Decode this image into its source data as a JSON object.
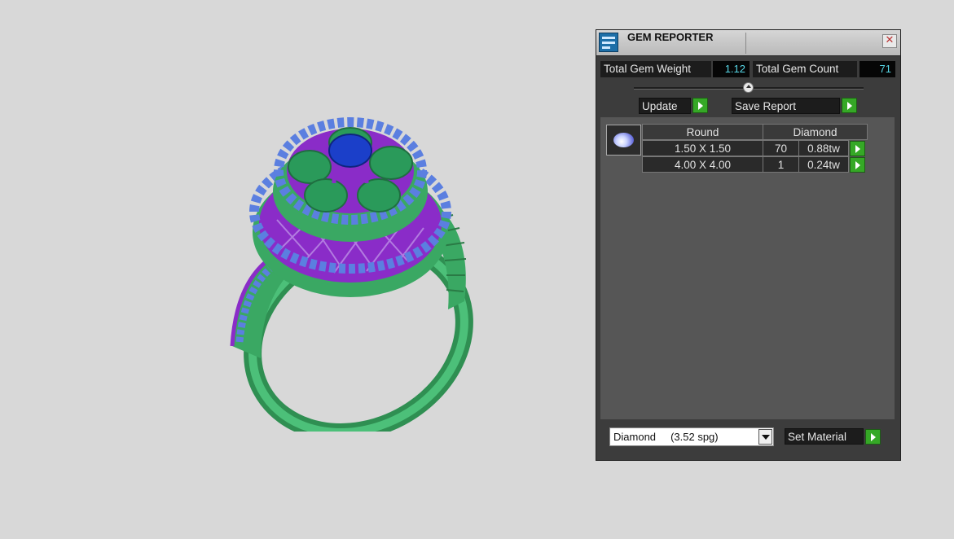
{
  "window": {
    "title": "GEM REPORTER",
    "close_icon": "close-icon",
    "app_icon": "gem-reporter-app-icon"
  },
  "totals": {
    "weight_label": "Total Gem Weight",
    "weight_value": "1.12",
    "count_label": "Total Gem Count",
    "count_value": "71"
  },
  "actions": {
    "update_label": "Update",
    "save_report_label": "Save Report",
    "set_material_label": "Set Material"
  },
  "gem_table": {
    "headers": [
      "Round",
      "Diamond"
    ],
    "rows": [
      {
        "size": "1.50 X 1.50",
        "count": "70",
        "weight": "0.88tw"
      },
      {
        "size": "4.00 X 4.00",
        "count": "1",
        "weight": "0.24tw"
      }
    ]
  },
  "material": {
    "selected": "Diamond     (3.52 spg)"
  },
  "colors": {
    "viewport_bg": "#d8d8d8",
    "panel_bg": "#3c3c3c",
    "value_text": "#58d8e8",
    "go_button": "#35a826",
    "ring_metal": "#3aa863",
    "ring_prongs": "#8a2cc8",
    "ring_gems": "#5b7fe0",
    "center_stone": "#1b3fc9"
  }
}
